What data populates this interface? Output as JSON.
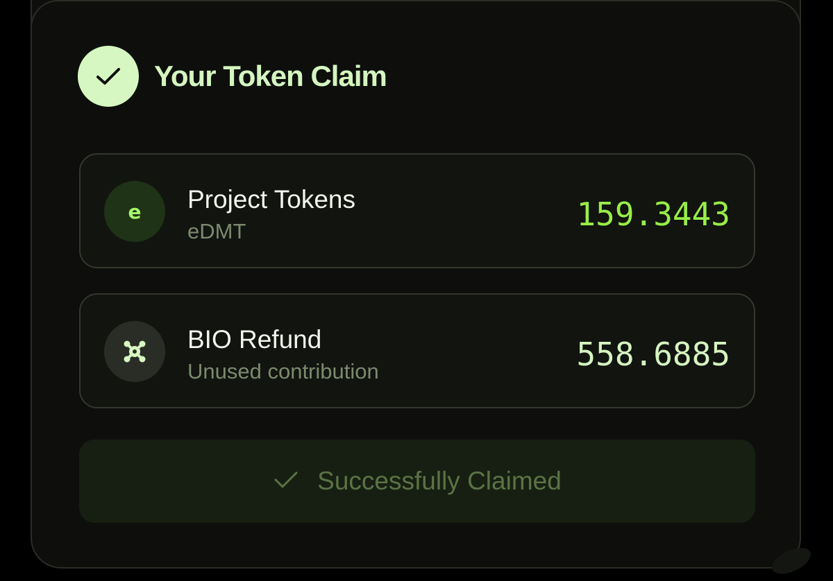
{
  "header": {
    "title": "Your Token Claim",
    "icon": "check-icon"
  },
  "rows": [
    {
      "icon_letter": "e",
      "icon": "edmt-token-icon",
      "title": "Project Tokens",
      "subtitle": "eDMT",
      "amount": "159.3443",
      "amount_color": "#98ee48"
    },
    {
      "icon": "bio-token-icon",
      "title": "BIO Refund",
      "subtitle": "Unused contribution",
      "amount": "558.6885",
      "amount_color": "#d5f4c0"
    }
  ],
  "claim_button": {
    "label": "Successfully Claimed",
    "icon": "check-icon"
  },
  "colors": {
    "accent": "#d7f7c2",
    "card_bg": "#0e0f0c",
    "border": "#2b2d25"
  }
}
